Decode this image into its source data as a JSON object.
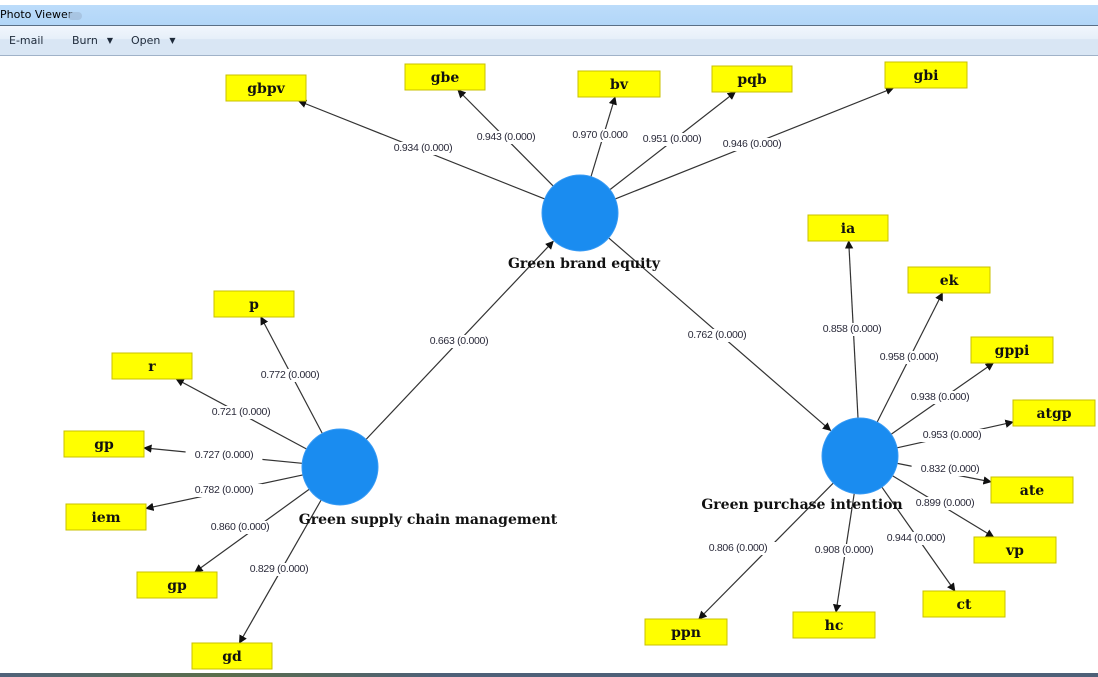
{
  "window": {
    "title": "Photo Viewer"
  },
  "toolbar": {
    "email_label": "E-mail",
    "burn_label": "Burn",
    "open_label": "Open",
    "dropdown_icon": "triangle-down"
  },
  "diagram": {
    "type": "structural-equation-model",
    "colors": {
      "construct_fill": "#1a8cf0",
      "indicator_fill": "#ffff00",
      "edge": "#333333"
    },
    "constructs": [
      {
        "id": "gscm",
        "label": "Green supply chain management"
      },
      {
        "id": "gbe",
        "label": "Green brand equity"
      },
      {
        "id": "gpi",
        "label": "Green purchase intention"
      }
    ],
    "paths": [
      {
        "from": "gscm",
        "to": "gbe",
        "coefficient": "0.663",
        "p_value": "0.000",
        "label": "0.663 (0.000)"
      },
      {
        "from": "gbe",
        "to": "gpi",
        "coefficient": "0.762",
        "p_value": "0.000",
        "label": "0.762 (0.000)"
      }
    ],
    "indicators": [
      {
        "construct": "gbe",
        "name": "gbpv",
        "loading": "0.934",
        "p_value": "0.000",
        "label": "0.934 (0.000)"
      },
      {
        "construct": "gbe",
        "name": "gbe",
        "loading": "0.943",
        "p_value": "0.000",
        "label": "0.943 (0.000)"
      },
      {
        "construct": "gbe",
        "name": "bv",
        "loading": "0.970",
        "p_value": "0.000",
        "label": "0.970 (0.000"
      },
      {
        "construct": "gbe",
        "name": "pqb",
        "loading": "0.951",
        "p_value": "0.000",
        "label": "0.951 (0.000)"
      },
      {
        "construct": "gbe",
        "name": "gbi",
        "loading": "0.946",
        "p_value": "0.000",
        "label": "0.946 (0.000)"
      },
      {
        "construct": "gscm",
        "name": "p",
        "loading": "0.772",
        "p_value": "0.000",
        "label": "0.772 (0.000)"
      },
      {
        "construct": "gscm",
        "name": "r",
        "loading": "0.721",
        "p_value": "0.000",
        "label": "0.721 (0.000)"
      },
      {
        "construct": "gscm",
        "name": "gp",
        "loading": "0.727",
        "p_value": "0.000",
        "label": "0.727 (0.000)"
      },
      {
        "construct": "gscm",
        "name": "iem",
        "loading": "0.782",
        "p_value": "0.000",
        "label": "0.782 (0.000)"
      },
      {
        "construct": "gscm",
        "name": "gp",
        "loading": "0.860",
        "p_value": "0.000",
        "label": "0.860 (0.000)"
      },
      {
        "construct": "gscm",
        "name": "gd",
        "loading": "0.829",
        "p_value": "0.000",
        "label": "0.829 (0.000)"
      },
      {
        "construct": "gpi",
        "name": "ia",
        "loading": "0.858",
        "p_value": "0.000",
        "label": "0.858 (0.000)"
      },
      {
        "construct": "gpi",
        "name": "ek",
        "loading": "0.958",
        "p_value": "0.000",
        "label": "0.958 (0.000)"
      },
      {
        "construct": "gpi",
        "name": "gppi",
        "loading": "0.938",
        "p_value": "0.000",
        "label": "0.938 (0.000)"
      },
      {
        "construct": "gpi",
        "name": "atgp",
        "loading": "0.953",
        "p_value": "0.000",
        "label": "0.953 (0.000)"
      },
      {
        "construct": "gpi",
        "name": "ate",
        "loading": "0.832",
        "p_value": "0.000",
        "label": "0.832 (0.000)"
      },
      {
        "construct": "gpi",
        "name": "vp",
        "loading": "0.899",
        "p_value": "0.000",
        "label": "0.899 (0.000)"
      },
      {
        "construct": "gpi",
        "name": "ct",
        "loading": "0.944",
        "p_value": "0.000",
        "label": "0.944 (0.000)"
      },
      {
        "construct": "gpi",
        "name": "hc",
        "loading": "0.908",
        "p_value": "0.000",
        "label": "0.908 (0.000)"
      },
      {
        "construct": "gpi",
        "name": "ppn",
        "loading": "0.806",
        "p_value": "0.000",
        "label": "0.806 (0.000)"
      }
    ]
  }
}
